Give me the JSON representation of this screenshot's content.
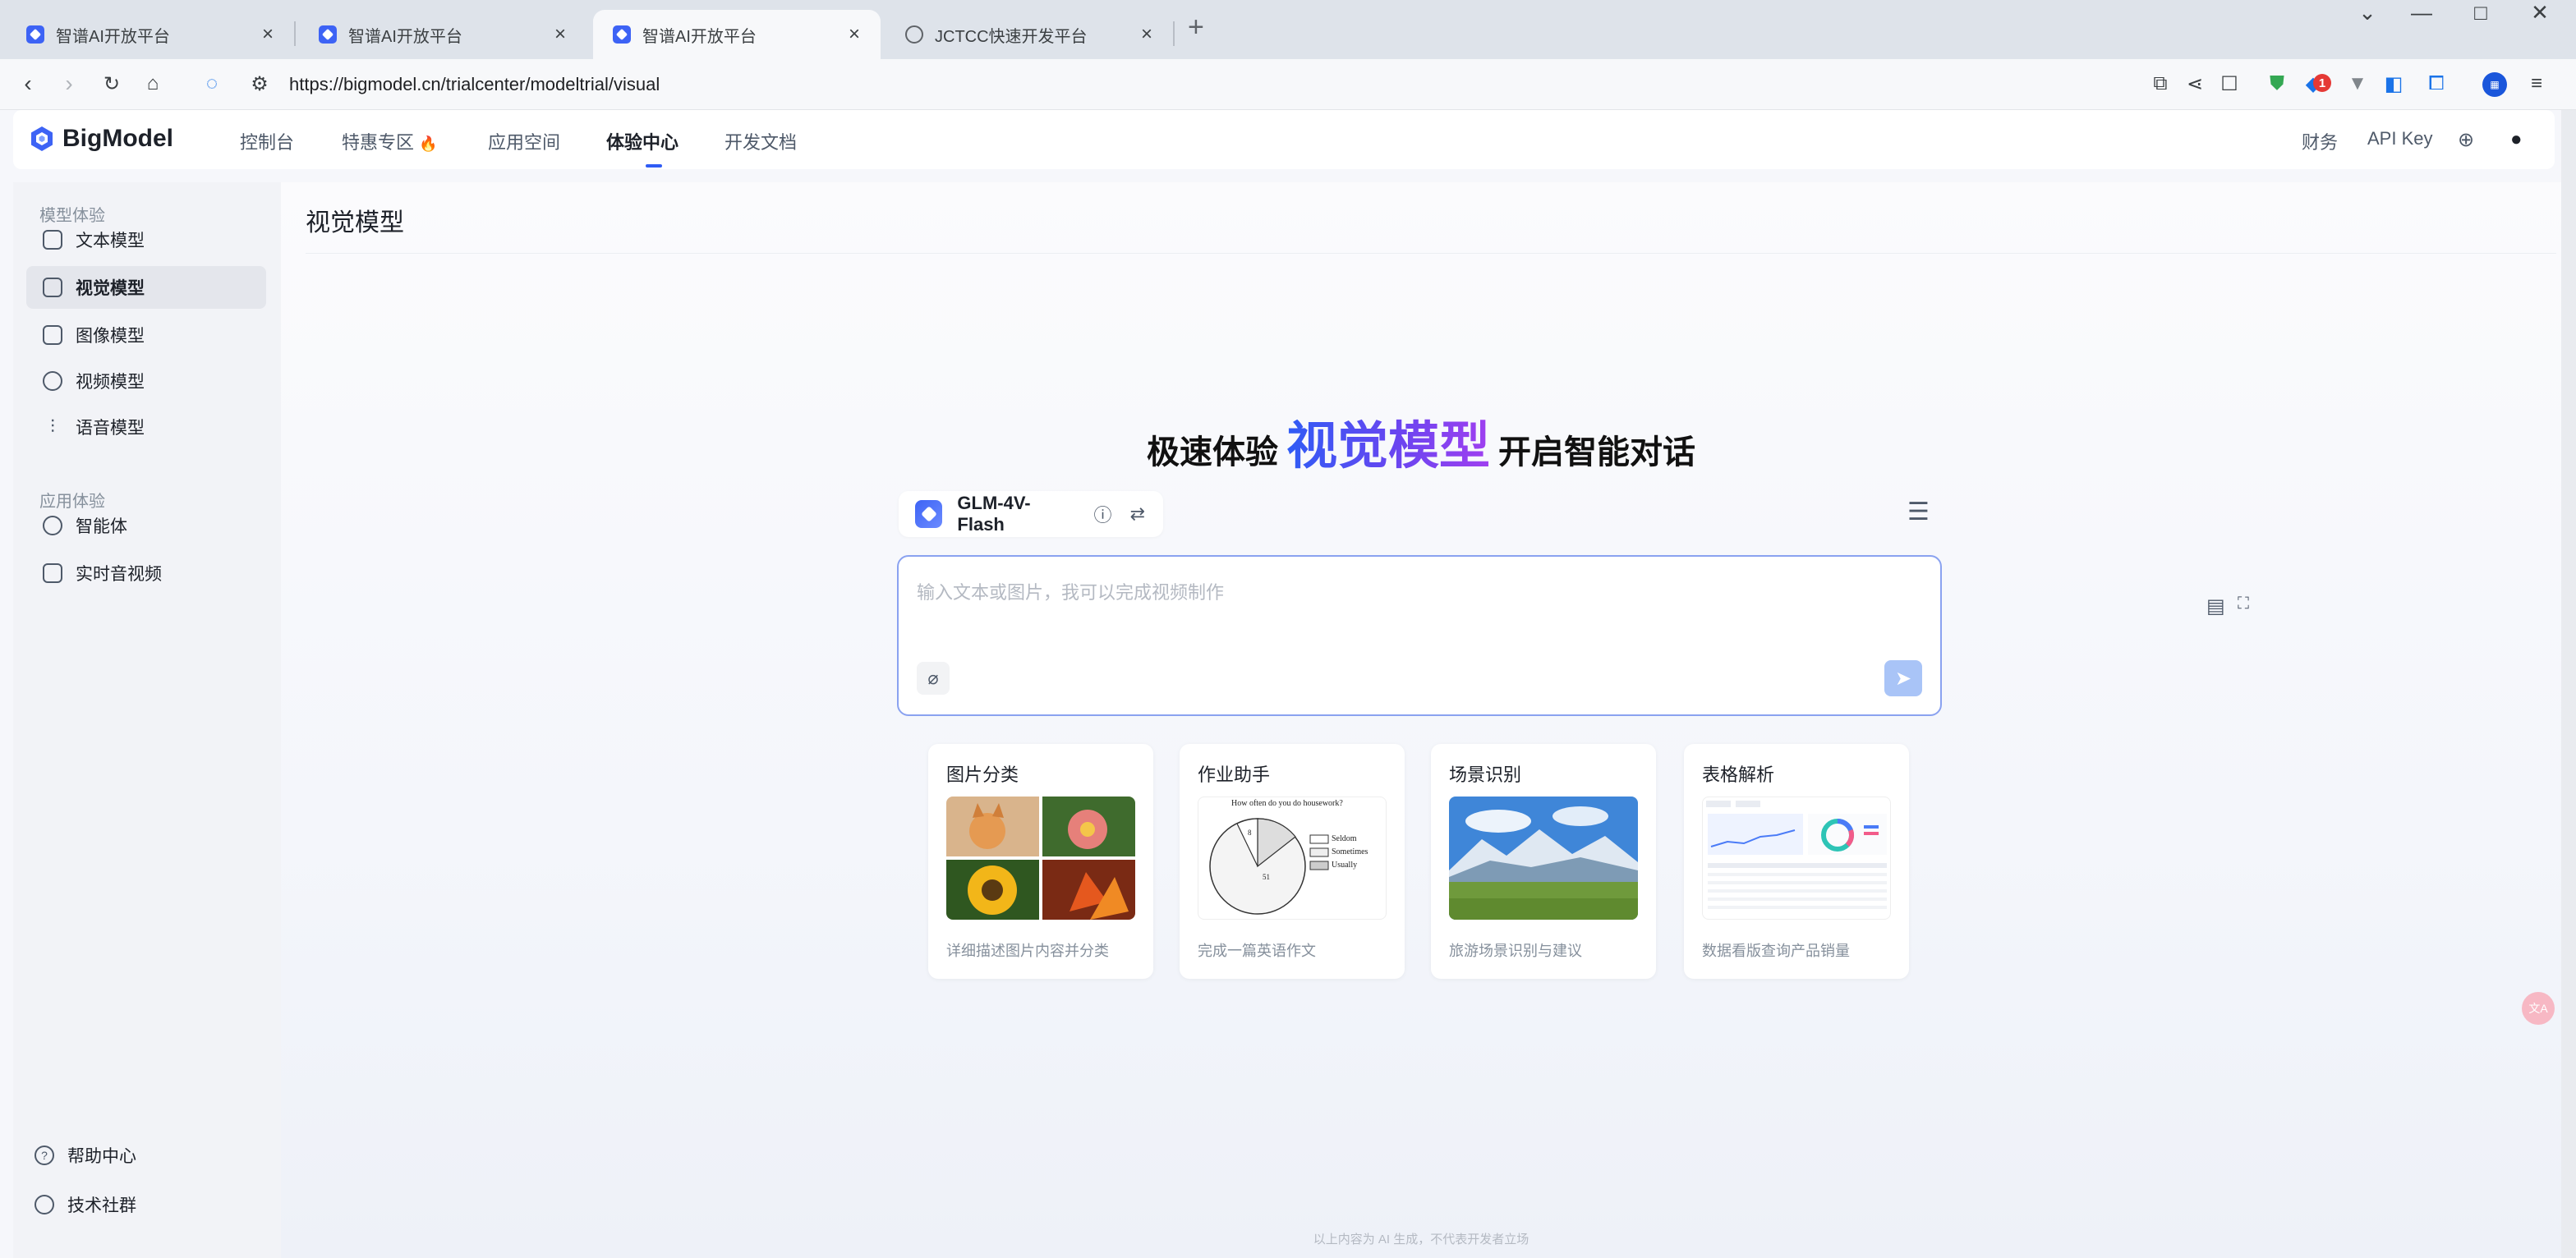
{
  "browser": {
    "tabs": [
      {
        "title": "智谱AI开放平台",
        "active": false
      },
      {
        "title": "智谱AI开放平台",
        "active": false
      },
      {
        "title": "智谱AI开放平台",
        "active": true
      },
      {
        "title": "JCTCC快速开发平台",
        "active": false
      }
    ],
    "url": "https://bigmodel.cn/trialcenter/modeltrial/visual",
    "extension_badge": "1"
  },
  "header": {
    "logo_text": "BigModel",
    "nav": [
      "控制台",
      "特惠专区",
      "应用空间",
      "体验中心",
      "开发文档"
    ],
    "fire_emoji": "🔥",
    "right": [
      "财务",
      "API Key"
    ]
  },
  "sidebar": {
    "group1": "模型体验",
    "group1_items": [
      "文本模型",
      "视觉模型",
      "图像模型",
      "视频模型",
      "语音模型"
    ],
    "group2": "应用体验",
    "group2_items": [
      "智能体",
      "实时音视频"
    ],
    "bottom": [
      "帮助中心",
      "技术社群"
    ]
  },
  "main": {
    "page_title": "视觉模型",
    "hero_prefix": "极速体验",
    "hero_accent": "视觉模型",
    "hero_suffix": "开启智能对话",
    "model_name": "GLM-4V-Flash",
    "input_placeholder": "输入文本或图片，我可以完成视频制作",
    "cards": [
      {
        "title": "图片分类",
        "desc": "详细描述图片内容并分类"
      },
      {
        "title": "作业助手",
        "desc": "完成一篇英语作文"
      },
      {
        "title": "场景识别",
        "desc": "旅游场景识别与建议"
      },
      {
        "title": "表格解析",
        "desc": "数据看版查询产品销量"
      }
    ],
    "homework_chart": {
      "title": "How often do you do housework?",
      "legend": [
        "Seldom",
        "Sometimes",
        "Usually"
      ],
      "labels": [
        "8",
        "51"
      ]
    },
    "footer_note": "以上内容为 AI 生成，不代表开发者立场"
  },
  "colors": {
    "accent": "#2f5cf5",
    "accent_purple": "#a03ff0"
  }
}
